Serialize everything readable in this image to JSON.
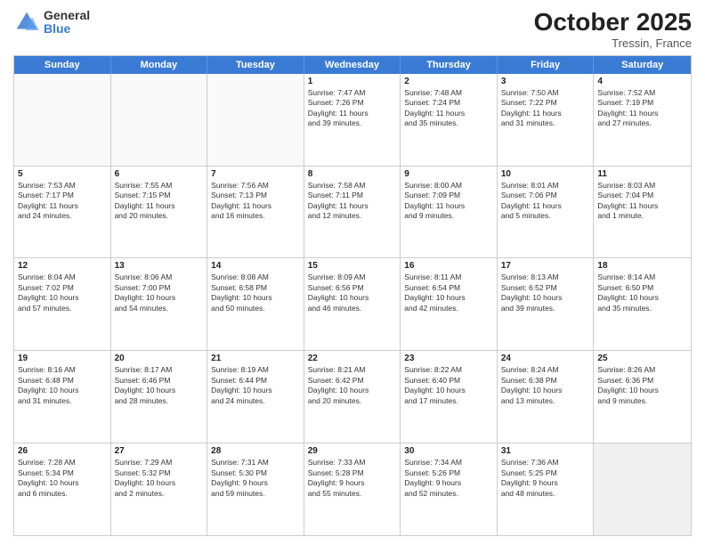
{
  "logo": {
    "general": "General",
    "blue": "Blue"
  },
  "header": {
    "month": "October 2025",
    "location": "Tressin, France"
  },
  "dayHeaders": [
    "Sunday",
    "Monday",
    "Tuesday",
    "Wednesday",
    "Thursday",
    "Friday",
    "Saturday"
  ],
  "weeks": [
    [
      {
        "day": "",
        "info": "",
        "empty": true
      },
      {
        "day": "",
        "info": "",
        "empty": true
      },
      {
        "day": "",
        "info": "",
        "empty": true
      },
      {
        "day": "1",
        "info": "Sunrise: 7:47 AM\nSunset: 7:26 PM\nDaylight: 11 hours\nand 39 minutes."
      },
      {
        "day": "2",
        "info": "Sunrise: 7:48 AM\nSunset: 7:24 PM\nDaylight: 11 hours\nand 35 minutes."
      },
      {
        "day": "3",
        "info": "Sunrise: 7:50 AM\nSunset: 7:22 PM\nDaylight: 11 hours\nand 31 minutes."
      },
      {
        "day": "4",
        "info": "Sunrise: 7:52 AM\nSunset: 7:19 PM\nDaylight: 11 hours\nand 27 minutes."
      }
    ],
    [
      {
        "day": "5",
        "info": "Sunrise: 7:53 AM\nSunset: 7:17 PM\nDaylight: 11 hours\nand 24 minutes."
      },
      {
        "day": "6",
        "info": "Sunrise: 7:55 AM\nSunset: 7:15 PM\nDaylight: 11 hours\nand 20 minutes."
      },
      {
        "day": "7",
        "info": "Sunrise: 7:56 AM\nSunset: 7:13 PM\nDaylight: 11 hours\nand 16 minutes."
      },
      {
        "day": "8",
        "info": "Sunrise: 7:58 AM\nSunset: 7:11 PM\nDaylight: 11 hours\nand 12 minutes."
      },
      {
        "day": "9",
        "info": "Sunrise: 8:00 AM\nSunset: 7:09 PM\nDaylight: 11 hours\nand 9 minutes."
      },
      {
        "day": "10",
        "info": "Sunrise: 8:01 AM\nSunset: 7:06 PM\nDaylight: 11 hours\nand 5 minutes."
      },
      {
        "day": "11",
        "info": "Sunrise: 8:03 AM\nSunset: 7:04 PM\nDaylight: 11 hours\nand 1 minute."
      }
    ],
    [
      {
        "day": "12",
        "info": "Sunrise: 8:04 AM\nSunset: 7:02 PM\nDaylight: 10 hours\nand 57 minutes."
      },
      {
        "day": "13",
        "info": "Sunrise: 8:06 AM\nSunset: 7:00 PM\nDaylight: 10 hours\nand 54 minutes."
      },
      {
        "day": "14",
        "info": "Sunrise: 8:08 AM\nSunset: 6:58 PM\nDaylight: 10 hours\nand 50 minutes."
      },
      {
        "day": "15",
        "info": "Sunrise: 8:09 AM\nSunset: 6:56 PM\nDaylight: 10 hours\nand 46 minutes."
      },
      {
        "day": "16",
        "info": "Sunrise: 8:11 AM\nSunset: 6:54 PM\nDaylight: 10 hours\nand 42 minutes."
      },
      {
        "day": "17",
        "info": "Sunrise: 8:13 AM\nSunset: 6:52 PM\nDaylight: 10 hours\nand 39 minutes."
      },
      {
        "day": "18",
        "info": "Sunrise: 8:14 AM\nSunset: 6:50 PM\nDaylight: 10 hours\nand 35 minutes."
      }
    ],
    [
      {
        "day": "19",
        "info": "Sunrise: 8:16 AM\nSunset: 6:48 PM\nDaylight: 10 hours\nand 31 minutes."
      },
      {
        "day": "20",
        "info": "Sunrise: 8:17 AM\nSunset: 6:46 PM\nDaylight: 10 hours\nand 28 minutes."
      },
      {
        "day": "21",
        "info": "Sunrise: 8:19 AM\nSunset: 6:44 PM\nDaylight: 10 hours\nand 24 minutes."
      },
      {
        "day": "22",
        "info": "Sunrise: 8:21 AM\nSunset: 6:42 PM\nDaylight: 10 hours\nand 20 minutes."
      },
      {
        "day": "23",
        "info": "Sunrise: 8:22 AM\nSunset: 6:40 PM\nDaylight: 10 hours\nand 17 minutes."
      },
      {
        "day": "24",
        "info": "Sunrise: 8:24 AM\nSunset: 6:38 PM\nDaylight: 10 hours\nand 13 minutes."
      },
      {
        "day": "25",
        "info": "Sunrise: 8:26 AM\nSunset: 6:36 PM\nDaylight: 10 hours\nand 9 minutes."
      }
    ],
    [
      {
        "day": "26",
        "info": "Sunrise: 7:28 AM\nSunset: 5:34 PM\nDaylight: 10 hours\nand 6 minutes."
      },
      {
        "day": "27",
        "info": "Sunrise: 7:29 AM\nSunset: 5:32 PM\nDaylight: 10 hours\nand 2 minutes."
      },
      {
        "day": "28",
        "info": "Sunrise: 7:31 AM\nSunset: 5:30 PM\nDaylight: 9 hours\nand 59 minutes."
      },
      {
        "day": "29",
        "info": "Sunrise: 7:33 AM\nSunset: 5:28 PM\nDaylight: 9 hours\nand 55 minutes."
      },
      {
        "day": "30",
        "info": "Sunrise: 7:34 AM\nSunset: 5:26 PM\nDaylight: 9 hours\nand 52 minutes."
      },
      {
        "day": "31",
        "info": "Sunrise: 7:36 AM\nSunset: 5:25 PM\nDaylight: 9 hours\nand 48 minutes."
      },
      {
        "day": "",
        "info": "",
        "empty": true,
        "shaded": true
      }
    ]
  ]
}
